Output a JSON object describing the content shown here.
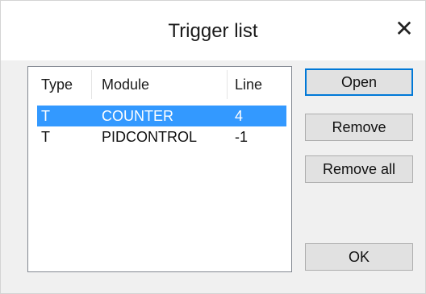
{
  "window": {
    "title": "Trigger list",
    "close_glyph": "✕"
  },
  "list": {
    "columns": [
      "Type",
      "Module",
      "Line"
    ],
    "rows": [
      {
        "type": "T",
        "module": "COUNTER",
        "line": "4",
        "selected": true
      },
      {
        "type": "T",
        "module": "PIDCONTROL",
        "line": "-1",
        "selected": false
      }
    ]
  },
  "buttons": {
    "open": "Open",
    "remove": "Remove",
    "remove_all": "Remove all",
    "ok": "OK"
  },
  "colors": {
    "selection": "#3399ff",
    "default_button_border": "#0078d7"
  }
}
